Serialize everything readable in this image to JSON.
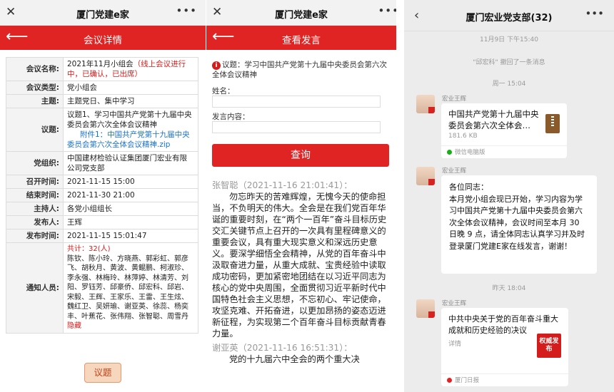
{
  "panel1": {
    "window_title": "厦门党建e家",
    "header_title": "会议详情",
    "rows": [
      {
        "label": "会议名称:",
        "value": "2021年11月小组会",
        "note": "（线上会议进行中，已确认，已出席）"
      },
      {
        "label": "会议类型:",
        "value": "党小组会"
      },
      {
        "label": "主题:",
        "value": "主题党日、集中学习"
      },
      {
        "label": "议题:",
        "value": "议题1、学习中国共产党第十九届中央委员会第六次全体会议精神",
        "attachment_prefix": "附件1：",
        "attachment": "中国共产党第十九届中央委员会第六次全体会议精神.zip"
      },
      {
        "label": "党组织:",
        "value": "中国建材检验认证集团厦门宏业有限公司党支部"
      },
      {
        "label": "召开时间:",
        "value": "2021-11-15 15:00"
      },
      {
        "label": "结束时间:",
        "value": "2021-11-30 21:00"
      },
      {
        "label": "主持人:",
        "value": "各党小组组长"
      },
      {
        "label": "发布人:",
        "value": "王辉"
      },
      {
        "label": "发布时间:",
        "value": "2021-11-15 15:01:47"
      },
      {
        "label": "通知人员:",
        "count": "共计：32(人)",
        "value": "陈钦、陈小玲、方晓燕、郭彩虹、郭彦飞、胡秋月、黄波、黄鲲鹏、柯淑珍、李永强、林梅玲、林萍婷、林清芳、刘阳、罗钰芳、邱豪侨、邱宏科、邱岩、宋毅、王辉、王家乐、王雷、王生炫、魏红卫、吴妍瑜、谢亚英、徐蕊、杨奕丰、叶蕉花、张伟翔、张智聪、周雪丹",
        "hide": "隐藏"
      }
    ],
    "topic_button": "议题"
  },
  "panel2": {
    "window_title": "厦门党建e家",
    "header_title": "查看发言",
    "topic": "议题：学习中国共产党第十九届中央委员会第六次全体会议精神",
    "name_label": "姓名：",
    "content_label": "发言内容：",
    "query_button": "查询",
    "speech1_author": "张智聪（2021-11-16 21:01:41）：",
    "speech1_text": "勿忘昨天的苦难辉煌，无愧今天的使命担当，不负明天的伟大。全会是在我们党百年华诞的重要时刻，在“两个一百年”奋斗目标历史交汇关键节点上召开的一次具有里程碑意义的重要会议，具有重大现实意义和深远历史意义。要深学细悟全会精神，从党的百年奋斗中汲取奋进力量，从重大成就、宝贵经验中读取成功密码，更加紧密地团结在以习近平同志为核心的党中央周围，全面贯彻习近平新时代中国特色社会主义思想，不忘初心、牢记使命，攻坚克难、开拓奋进，以更加昂扬的姿态迈进新征程，为实现第二个百年奋斗目标贡献青春力量。",
    "speech2_author": "谢亚英（2021-11-16 16:51:31）：",
    "speech2_text": "党的十九届六中全会的两个重大决"
  },
  "panel3": {
    "title": "厦门宏业党支部(32)",
    "ts1": "11月9日 下午15:40",
    "recall": "\"邱宏科\" 撤回了一条消息",
    "ts2": "周一 15:04",
    "sender": "宏业王辉",
    "file_title": "中国共产党第十九届中央委员会第六次全体会…",
    "file_size": "181.6 KB",
    "file_source": "微信电脑版",
    "text_msg": "各位同志：\n本月党小组会现已开始，学习内容为学习中国共产党第十九届中央委员会第六次全体会议精神，会议时间至本月 30 日晚 9 点，请全体同志认真学习并及时登录厦门党建E家在线发言，谢谢！",
    "ts3": "昨天 18:04",
    "link_title": "中共中央关于党的百年奋斗重大成就和历史经验的决议",
    "link_desc": "详情",
    "link_logo": "权威发布",
    "link_source": "厦门日报",
    "colors": {
      "red": "#e02424",
      "wx_green": "#1aad19"
    }
  }
}
